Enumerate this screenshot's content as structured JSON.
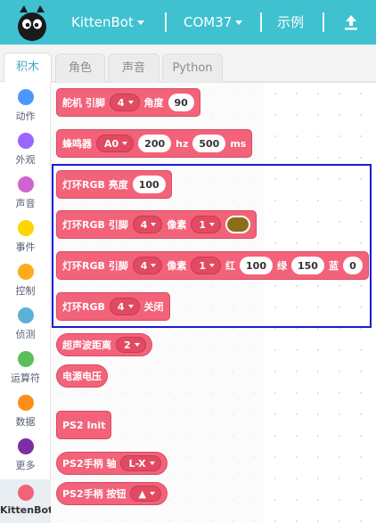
{
  "topbar": {
    "brand": "KittenBot",
    "port": "COM37",
    "examples": "示例",
    "colors": {
      "bar": "#3fc1d0"
    }
  },
  "tabs": [
    {
      "label": "积木",
      "active": true
    },
    {
      "label": "角色",
      "active": false
    },
    {
      "label": "声音",
      "active": false
    },
    {
      "label": "Python",
      "active": false
    }
  ],
  "categories": [
    {
      "label": "动作",
      "color": "#4c97ff"
    },
    {
      "label": "外观",
      "color": "#9966ff"
    },
    {
      "label": "声音",
      "color": "#cf63cf"
    },
    {
      "label": "事件",
      "color": "#ffd500"
    },
    {
      "label": "控制",
      "color": "#ffab19"
    },
    {
      "label": "侦测",
      "color": "#5cb1d6"
    },
    {
      "label": "运算符",
      "color": "#59c059"
    },
    {
      "label": "数据",
      "color": "#ff8c1a"
    },
    {
      "label": "更多",
      "color": "#7e2ea4"
    },
    {
      "label": "KittenBot",
      "color": "#f2637a"
    }
  ],
  "blocks": {
    "servo": {
      "t1": "舵机 引脚",
      "pin": "4",
      "t2": "角度",
      "angle": "90"
    },
    "buzzer": {
      "t1": "蜂鸣器",
      "pin": "A0",
      "freq": "200",
      "t2": "hz",
      "dur": "500",
      "t3": "ms"
    },
    "ring_brightness": {
      "t1": "灯环RGB 亮度",
      "value": "100"
    },
    "ring_pixel_color": {
      "t1": "灯环RGB 引脚",
      "pin": "4",
      "t2": "像素",
      "pixel": "1"
    },
    "ring_pixel_rgb": {
      "t1": "灯环RGB 引脚",
      "pin": "4",
      "t2": "像素",
      "pixel": "1",
      "t3": "红",
      "r": "100",
      "t4": "绿",
      "g": "150",
      "t5": "蓝",
      "b": "0"
    },
    "ring_off": {
      "t1": "灯环RGB",
      "pin": "4",
      "t2": "关闭"
    },
    "ultrasonic": {
      "t1": "超声波距离",
      "pin": "2"
    },
    "battery": {
      "t1": "电源电压"
    },
    "ps2_init": {
      "t1": "PS2 Init"
    },
    "ps2_axis": {
      "t1": "PS2手柄 轴",
      "axis": "L-X"
    },
    "ps2_button": {
      "t1": "PS2手柄 按钮",
      "btn": "▲"
    }
  },
  "colors": {
    "block": "#f2637a",
    "highlight": "#1a1ad6",
    "swatch": "#8a6e1c"
  }
}
